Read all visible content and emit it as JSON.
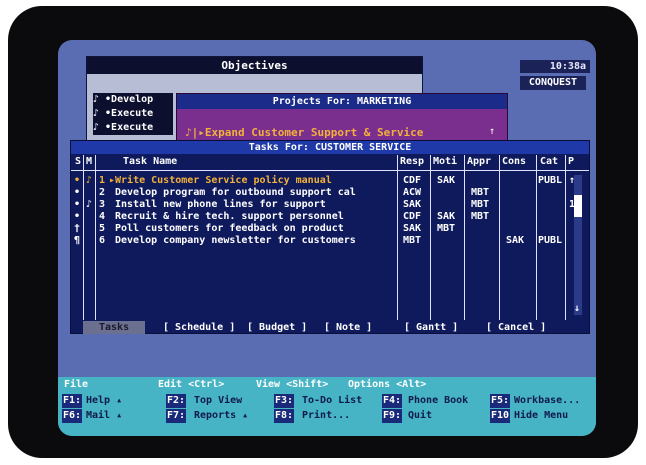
{
  "objectives_window": {
    "title": "Objectives",
    "items": [
      "♪ •Develop",
      "♪ •Execute",
      "♪ •Execute"
    ]
  },
  "status": {
    "clock": "10:38a",
    "brand": "CONQUEST"
  },
  "projects_window": {
    "title": "Projects For: MARKETING",
    "item": "♪|▸Expand Customer Support & Service",
    "scroll_glyph": "↑"
  },
  "tasks_window": {
    "title": "Tasks For: CUSTOMER SERVICE",
    "columns": {
      "s": "S",
      "m": "M",
      "name": "Task Name",
      "resp": "Resp",
      "moti": "Moti",
      "appr": "Appr",
      "cons": "Cons",
      "cat": "Cat",
      "p": "P"
    },
    "rows": [
      {
        "s": "•",
        "m": "♪",
        "num": "1",
        "name": "▸Write Customer Service policy manual",
        "resp": "CDF",
        "moti": "SAK",
        "appr": "",
        "cons": "",
        "cat": "PUBL",
        "p": "↑"
      },
      {
        "s": "•",
        "m": "",
        "num": "2",
        "name": "Develop program for outbound support cal",
        "resp": "ACW",
        "moti": "",
        "appr": "MBT",
        "cons": "",
        "cat": "",
        "p": ""
      },
      {
        "s": "•",
        "m": "♪",
        "num": "3",
        "name": "Install new phone lines for support",
        "resp": "SAK",
        "moti": "",
        "appr": "MBT",
        "cons": "",
        "cat": "",
        "p": "1"
      },
      {
        "s": "•",
        "m": "",
        "num": "4",
        "name": "Recruit & hire tech. support personnel",
        "resp": "CDF",
        "moti": "SAK",
        "appr": "MBT",
        "cons": "",
        "cat": "",
        "p": ""
      },
      {
        "s": "†",
        "m": "",
        "num": "5",
        "name": "Poll customers for feedback on product",
        "resp": "SAK",
        "moti": "MBT",
        "appr": "",
        "cons": "",
        "cat": "",
        "p": ""
      },
      {
        "s": "¶",
        "m": "",
        "num": "6",
        "name": "Develop company newsletter for customers",
        "resp": "MBT",
        "moti": "",
        "appr": "",
        "cons": "SAK",
        "cat": "PUBL",
        "p": ""
      }
    ],
    "scroll_down_glyph": "↓",
    "buttons": {
      "tasks": "Tasks",
      "schedule": "[ Schedule ]",
      "budget": "[ Budget  ]",
      "note": "[  Note   ]",
      "gantt": "[ Gantt  ]",
      "cancel": "[ Cancel ]"
    }
  },
  "menu_bar": {
    "file": "File",
    "edit": "Edit <Ctrl>",
    "view": "View <Shift>",
    "options": "Options <Alt>",
    "keys": [
      {
        "key": "F1:",
        "label": "Help ▴"
      },
      {
        "key": "F2:",
        "label": "Top View"
      },
      {
        "key": "F3:",
        "label": "To-Do List"
      },
      {
        "key": "F4:",
        "label": "Phone Book"
      },
      {
        "key": "F5:",
        "label": "Workbase..."
      },
      {
        "key": "F6:",
        "label": "Mail ▴"
      },
      {
        "key": "F7:",
        "label": "Reports ▴"
      },
      {
        "key": "F8:",
        "label": "Print..."
      },
      {
        "key": "F9:",
        "label": "Quit"
      },
      {
        "key": "F10",
        "label": "Hide Menu"
      }
    ]
  },
  "colors": {
    "desktop": "#5a6db3",
    "task_window": "#0f1a5c",
    "highlight": "#f3b13a",
    "menu": "#46b4c4",
    "project_window": "#7a2e8e"
  }
}
